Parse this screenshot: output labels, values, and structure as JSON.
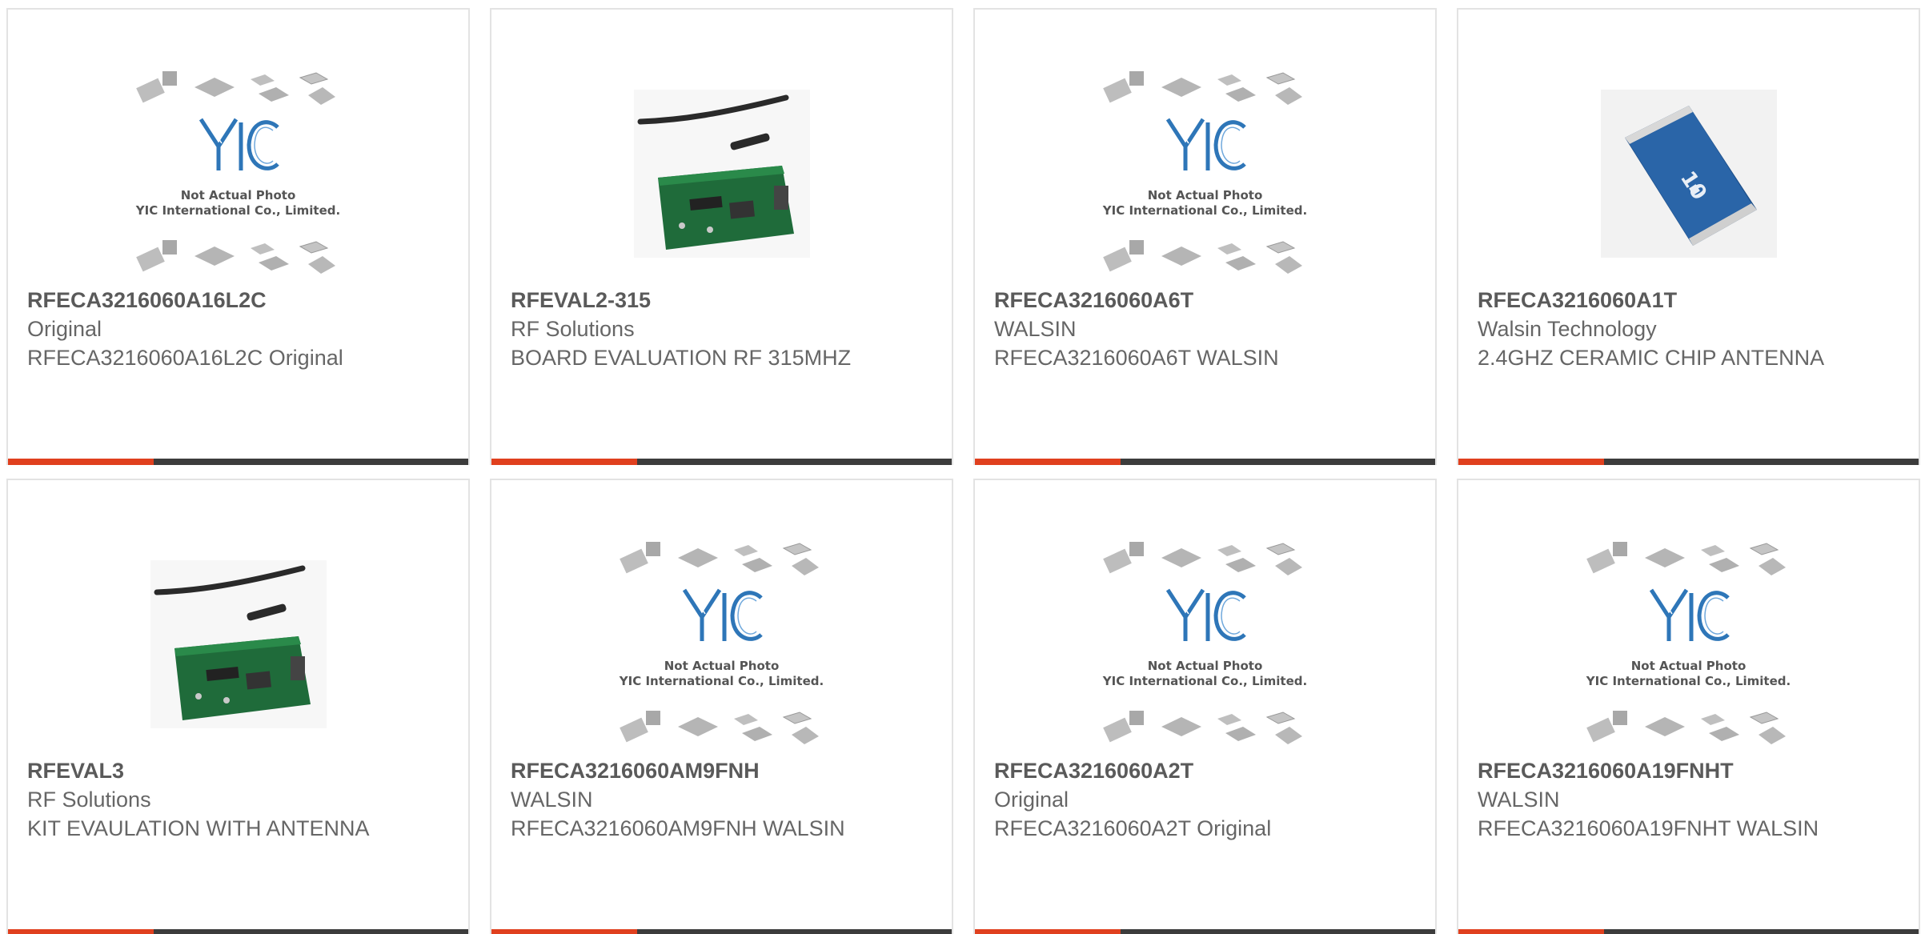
{
  "colors": {
    "accent": "#e0401e",
    "bar": "#3c3c3c",
    "border": "#e3e3e3",
    "text": "#666666"
  },
  "placeholder": {
    "line1": "Not Actual Photo",
    "line2": "YIC International Co., Limited."
  },
  "products": [
    {
      "part": "RFECA3216060A16L2C",
      "mfr": "Original",
      "desc": "RFECA3216060A16L2C Original",
      "image": "placeholder-photo"
    },
    {
      "part": "RFEVAL2-315",
      "mfr": "RF Solutions",
      "desc": "BOARD EVALUATION RF 315MHZ",
      "image": "eval-board-photo"
    },
    {
      "part": "RFECA3216060A6T",
      "mfr": "WALSIN",
      "desc": "RFECA3216060A6T WALSIN",
      "image": "placeholder-photo"
    },
    {
      "part": "RFECA3216060A1T",
      "mfr": "Walsin Technology",
      "desc": "2.4GHZ CERAMIC CHIP ANTENNA",
      "image": "chip-antenna-photo"
    },
    {
      "part": "RFEVAL3",
      "mfr": "RF Solutions",
      "desc": "KIT EVAULATION WITH ANTENNA",
      "image": "eval-board-photo"
    },
    {
      "part": "RFECA3216060AM9FNH",
      "mfr": "WALSIN",
      "desc": "RFECA3216060AM9FNH WALSIN",
      "image": "placeholder-photo"
    },
    {
      "part": "RFECA3216060A2T",
      "mfr": "Original",
      "desc": "RFECA3216060A2T Original",
      "image": "placeholder-photo"
    },
    {
      "part": "RFECA3216060A19FNHT",
      "mfr": "WALSIN",
      "desc": "RFECA3216060A19FNHT WALSIN",
      "image": "placeholder-photo"
    }
  ]
}
